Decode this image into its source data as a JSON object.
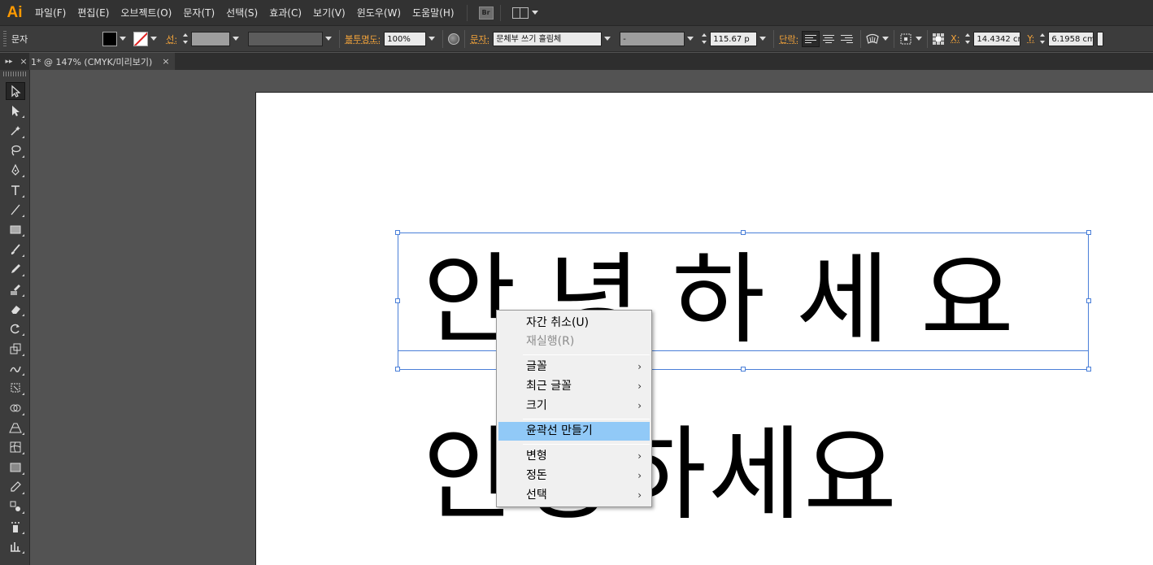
{
  "app": {
    "logo": "Ai",
    "brand_color": "#ff9a00"
  },
  "menubar": {
    "items": [
      "파일(F)",
      "편집(E)",
      "오브젝트(O)",
      "문자(T)",
      "선택(S)",
      "효과(C)",
      "보기(V)",
      "윈도우(W)",
      "도움말(H)"
    ],
    "bridge_label": "Br"
  },
  "controlbar": {
    "type_label": "문자",
    "stroke_label": "선:",
    "stroke_weight": "",
    "opacity_label": "불투명도:",
    "opacity_value": "100%",
    "char_label": "문자:",
    "font_family": "문체부 쓰기 흘림체",
    "font_style": "-",
    "font_size": "115.67 p",
    "paragraph_label": "단락:",
    "x_label": "X:",
    "x_value": "14.4342 cm",
    "y_label": "Y:",
    "y_value": "6.1958 cm"
  },
  "tab": {
    "title": "1* @ 147% (CMYK/미리보기)",
    "close": "×",
    "collapse": "▸▸",
    "close_left": "×"
  },
  "tools": [
    "selection-tool",
    "direct-selection-tool",
    "magic-wand-tool",
    "lasso-tool",
    "pen-tool",
    "type-tool",
    "line-tool",
    "rectangle-tool",
    "paintbrush-tool",
    "pencil-tool",
    "blob-brush-tool",
    "eraser-tool",
    "rotate-tool",
    "scale-tool",
    "warp-tool",
    "free-transform-tool",
    "shape-builder-tool",
    "perspective-grid-tool",
    "mesh-tool",
    "gradient-tool",
    "eyedropper-tool",
    "blend-tool",
    "symbol-sprayer-tool",
    "column-graph-tool"
  ],
  "canvas": {
    "line1": "안녕하세요",
    "line2": "안녕하세요"
  },
  "context_menu": {
    "items": [
      {
        "label": "자간 취소(U)",
        "state": "normal",
        "submenu": false
      },
      {
        "label": "재실행(R)",
        "state": "disabled",
        "submenu": false
      },
      {
        "label": "글꼴",
        "state": "normal",
        "submenu": true
      },
      {
        "label": "최근 글꼴",
        "state": "normal",
        "submenu": true
      },
      {
        "label": "크기",
        "state": "normal",
        "submenu": true
      },
      {
        "label": "윤곽선 만들기",
        "state": "highlight",
        "submenu": false
      },
      {
        "label": "변형",
        "state": "normal",
        "submenu": true
      },
      {
        "label": "정돈",
        "state": "normal",
        "submenu": true
      },
      {
        "label": "선택",
        "state": "normal",
        "submenu": true
      }
    ],
    "submenu_arrow": "›"
  }
}
